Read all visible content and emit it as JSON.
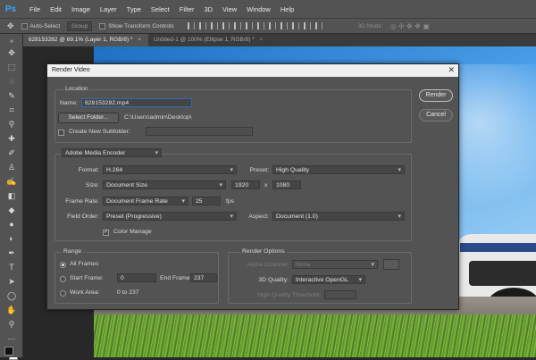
{
  "app": {
    "logo": "Ps",
    "menu": [
      "File",
      "Edit",
      "Image",
      "Layer",
      "Type",
      "Select",
      "Filter",
      "3D",
      "View",
      "Window",
      "Help"
    ]
  },
  "options_bar": {
    "auto_select": "Auto-Select",
    "group": "Group",
    "show_transform": "Show Transform Controls",
    "mode_3d": "3D Mode:"
  },
  "tabs": [
    {
      "label": "628153282 @ 69.1% (Layer 1, RGB/8) *"
    },
    {
      "label": "Untitled-1 @ 100% (Ellipse 1, RGB/8) *"
    }
  ],
  "dialog": {
    "title": "Render Video",
    "close": "✕",
    "location": {
      "section_title": "Location",
      "name_label": "Name:",
      "name_value": "628153282.mp4",
      "select_folder": "Select Folder...",
      "folder_path": "C:\\Users\\admin\\Desktop\\",
      "create_subfolder": "Create New Subfolder:"
    },
    "encoder": {
      "selected": "Adobe Media Encoder",
      "format_label": "Format:",
      "format_value": "H.264",
      "preset_label": "Preset:",
      "preset_value": "High Quality",
      "size_label": "Size:",
      "size_value": "Document Size",
      "width": "1920",
      "x": "x",
      "height": "1080",
      "frame_rate_label": "Frame Rate:",
      "frame_rate_value": "Document Frame Rate",
      "fps_value": "25",
      "fps_unit": "fps",
      "field_order_label": "Field Order:",
      "field_order_value": "Preset (Progressive)",
      "aspect_label": "Aspect:",
      "aspect_value": "Document (1.0)",
      "color_manage": "Color Manage",
      "color_manage_checked": true
    },
    "range": {
      "section_title": "Range",
      "all_frames": "All Frames",
      "start_frame_label": "Start Frame:",
      "start_frame_value": "0",
      "end_frame_label": "End Frame:",
      "end_frame_value": "237",
      "work_area_label": "Work Area:",
      "work_area_value": "0 to 237"
    },
    "render_options": {
      "section_title": "Render Options",
      "alpha_channel_label": "Alpha Channel:",
      "alpha_channel_value": "None",
      "quality_3d_label": "3D Quality:",
      "quality_3d_value": "Interactive OpenGL",
      "hq_threshold_label": "High Quality Threshold:",
      "hq_threshold_value": ""
    },
    "buttons": {
      "render": "Render",
      "cancel": "Cancel"
    }
  }
}
